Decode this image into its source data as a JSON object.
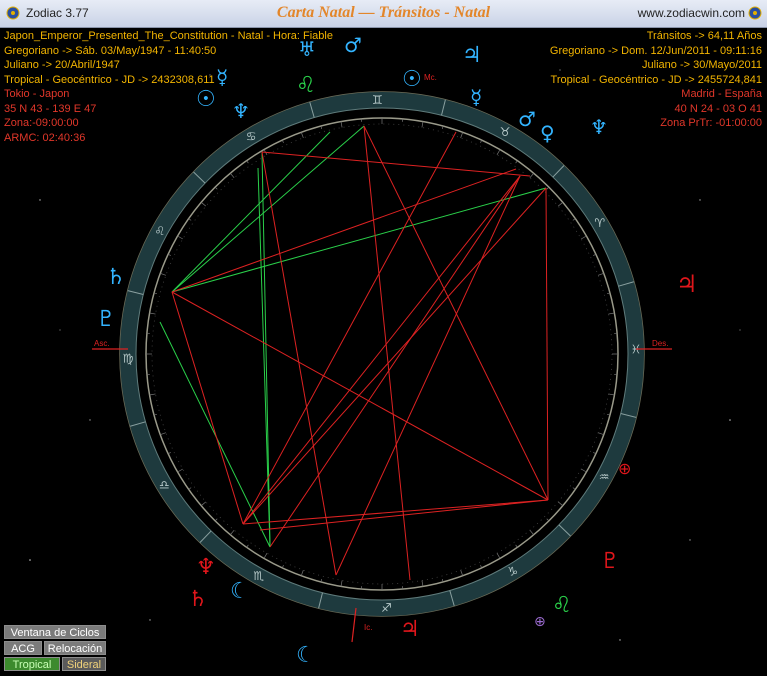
{
  "window": {
    "app_name": "Zodiac 3.77",
    "title": "Carta Natal — Tránsitos - Natal",
    "website": "www.zodiacwin.com"
  },
  "natal": {
    "name": "Japon_Emperor_Presented_The_Constitution - Natal - Hora: Fiable",
    "gregorian": "Gregoriano -> Sáb. 03/May/1947 - 11:40:50",
    "julian": "Juliano -> 20/Abril/1947",
    "jd": "Tropical - Geocéntrico - JD -> 2432308,611",
    "place": "Tokio - Japon",
    "coords": "35 N 43 - 139 E 47",
    "zone": "Zona:-09:00:00",
    "armc": "ARMC: 02:40:36"
  },
  "transit": {
    "age": "Tránsitos -> 64,11 Años",
    "gregorian": "Gregoriano -> Dom. 12/Jun/2011 - 09:11:16",
    "julian": "Juliano -> 30/Mayo/2011",
    "jd": "Tropical - Geocéntrico - JD -> 2455724,841",
    "place": "Madrid - España",
    "coords": "40 N 24 - 03 O 41",
    "zone": "Zona PrTr: -01:00:00"
  },
  "angles": {
    "asc": "Asc.",
    "des": "Des.",
    "mc": "Mc.",
    "ic": "Ic."
  },
  "signs": [
    "taurus-icon",
    "aries-icon",
    "pisces-icon",
    "aquarius-icon",
    "capricorn-icon",
    "sagittarius-icon",
    "scorpio-icon",
    "libra-icon",
    "virgo-icon",
    "leo-icon",
    "cancer-icon",
    "gemini-icon"
  ],
  "buttons": {
    "ciclos": "Ventana de Ciclos",
    "acg": "ACG",
    "relocacion": "Relocación",
    "tropical": "Tropical",
    "sideral": "Sideral"
  },
  "colors": {
    "accent": "#e3862a",
    "natal_text": "#f2b400",
    "transit_text": "#e1372a",
    "ring": "#1e3a3e",
    "natal_planet": "#33b4ff",
    "transit_planet": "#e0161b",
    "green_planet": "#2ad04a"
  }
}
